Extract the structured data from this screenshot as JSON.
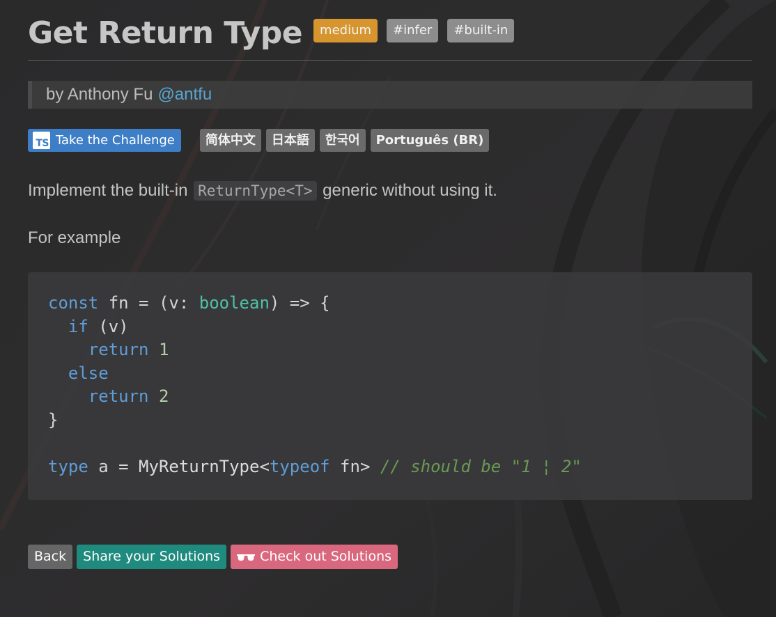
{
  "header": {
    "title": "Get Return Type",
    "difficulty": "medium",
    "tags": [
      "#infer",
      "#built-in"
    ]
  },
  "author": {
    "prefix": "by Anthony Fu",
    "handle": "@antfu"
  },
  "actions": {
    "challenge_icon": "TS",
    "challenge_label": "Take the Challenge",
    "languages": [
      "简体中文",
      "日本語",
      "한국어",
      "Português (BR)"
    ]
  },
  "body": {
    "intro_before": "Implement the built-in",
    "intro_code": "ReturnType<T>",
    "intro_after": "generic without using it.",
    "example_label": "For example"
  },
  "code": {
    "l1": [
      "const",
      " fn = (v: ",
      "boolean",
      ") => {"
    ],
    "l2": [
      "  ",
      "if",
      " (v)"
    ],
    "l3": [
      "    ",
      "return",
      " ",
      "1"
    ],
    "l4": [
      "  ",
      "else"
    ],
    "l5": [
      "    ",
      "return",
      " ",
      "2"
    ],
    "l6": "}",
    "l8": [
      "type",
      " a = ",
      "MyReturnType",
      "<",
      "typeof",
      " fn> ",
      "// should be \"1 ¦ 2\""
    ]
  },
  "footer": {
    "back_label": "Back",
    "share_label": "Share your Solutions",
    "check_label": "Check out Solutions"
  },
  "colors": {
    "medium": "#d7952f",
    "tag": "#8d8d8d",
    "challenge": "#3d7ec6",
    "share": "#1f8a7e",
    "check": "#d9677d",
    "link": "#5aa6d0"
  }
}
